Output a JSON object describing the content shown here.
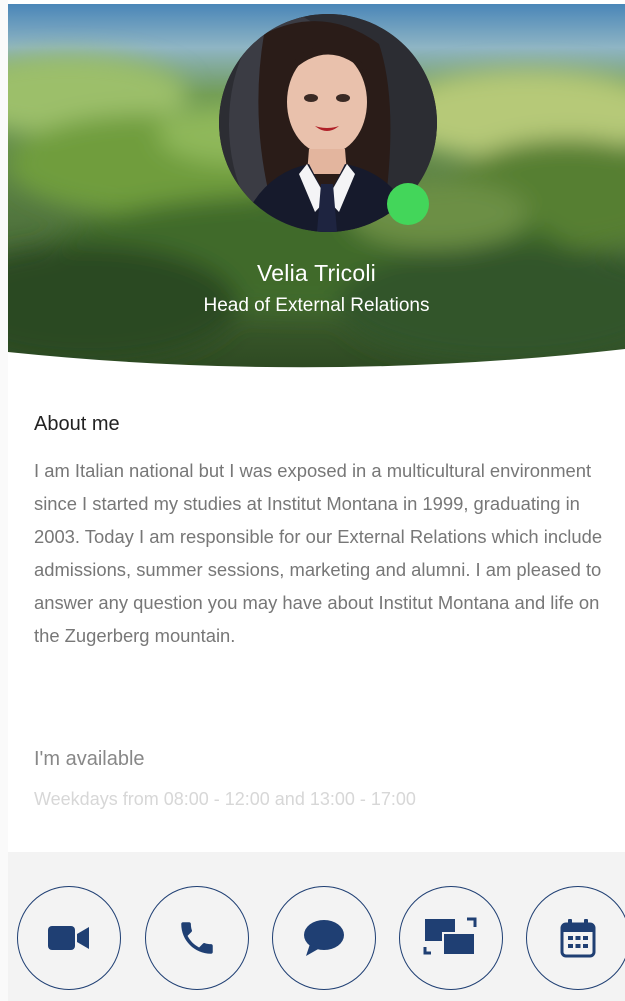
{
  "profile": {
    "name": "Velia Tricoli",
    "role": "Head of External Relations",
    "status_color": "#43d65a"
  },
  "about": {
    "title": "About me",
    "text": "I am Italian national but I was exposed in a multicultural environment since I started my studies at Institut Montana in 1999, graduating in 2003. Today I am responsible for our External Relations which include admissions, summer sessions, marketing and alumni. I am pleased to answer any question you may have about Institut Montana and life on the Zugerberg mountain."
  },
  "availability": {
    "title": "I'm available",
    "text": "Weekdays from 08:00 - 12:00 and 13:00 - 17:00"
  },
  "actions": [
    {
      "icon": "video-camera-icon"
    },
    {
      "icon": "phone-icon"
    },
    {
      "icon": "chat-bubble-icon"
    },
    {
      "icon": "screen-share-icon"
    },
    {
      "icon": "calendar-icon"
    }
  ],
  "colors": {
    "accent": "#1f3f73",
    "action_bar_bg": "#f3f3f3"
  }
}
